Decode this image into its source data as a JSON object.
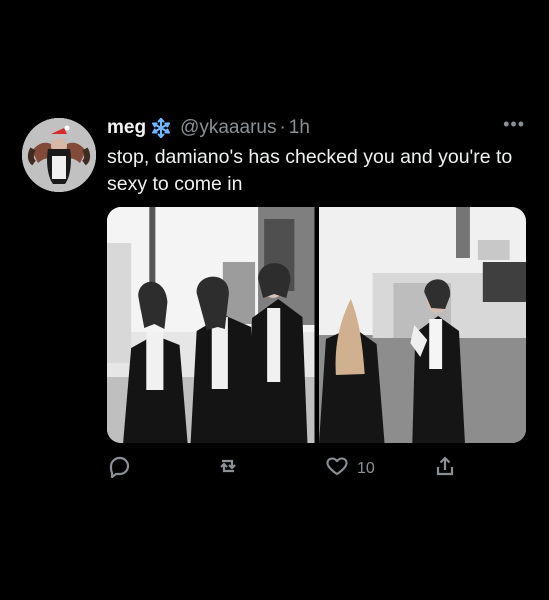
{
  "tweet": {
    "display_name": "meg",
    "name_badge_icon": "snowflake-icon",
    "handle": "@ykaaarus",
    "dot": "·",
    "time": "1h",
    "more_label": "•••",
    "text": "stop, damiano's has checked you and you're to sexy to come in",
    "media": {
      "count": 2,
      "style": "black-and-white"
    },
    "actions": {
      "reply_icon": "reply-icon",
      "retweet_icon": "retweet-icon",
      "like_icon": "heart-icon",
      "like_count": "10",
      "share_icon": "share-icon"
    },
    "colors": {
      "background": "#000000",
      "text": "#e7e9ea",
      "muted": "#8b9096",
      "badge": "#1d9bf0"
    }
  }
}
